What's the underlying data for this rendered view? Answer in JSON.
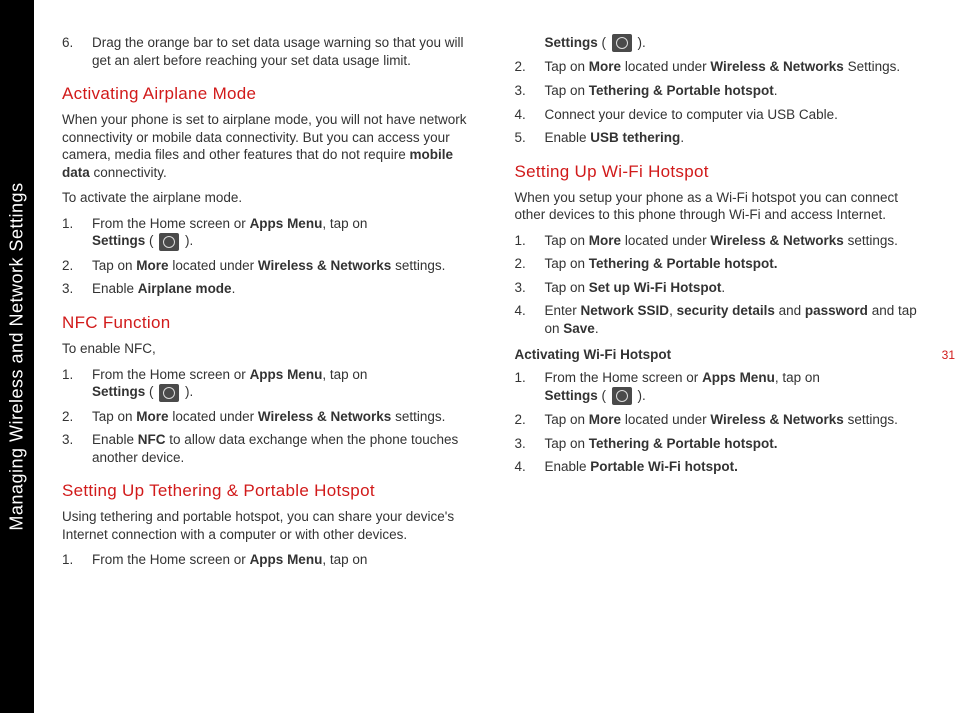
{
  "sidebar": {
    "title": "Managing Wireless and Network Settings"
  },
  "page_number": "31",
  "left": {
    "item6_num": "6.",
    "item6_text": "Drag the orange bar to set data usage warning so that you will get an alert before reaching your set data usage limit.",
    "heading_airplane": "Activating Airplane Mode",
    "airplane_intro_1": "When your phone is set to airplane mode, you will not have network connectivity or mobile data connectivity. But you can access your camera, media files and other features that do not require ",
    "airplane_intro_bold": "mobile data",
    "airplane_intro_2": " connectivity.",
    "airplane_activate": "To activate the airplane mode.",
    "airplane_steps": {
      "s1_num": "1.",
      "s1_a": "From the Home screen or ",
      "s1_b": "Apps Menu",
      "s1_c": ", tap on ",
      "s1_d": "Settings",
      "s1_e": " ( ",
      "s1_f": " ).",
      "s2_num": "2.",
      "s2_a": "Tap on ",
      "s2_b": "More",
      "s2_c": " located under ",
      "s2_d": "Wireless & Networks",
      "s2_e": " settings.",
      "s3_num": "3.",
      "s3_a": "Enable ",
      "s3_b": "Airplane mode",
      "s3_c": "."
    },
    "heading_nfc": "NFC Function",
    "nfc_intro": "To enable NFC,",
    "nfc_steps": {
      "s1_num": "1.",
      "s1_a": "From the Home screen or ",
      "s1_b": "Apps Menu",
      "s1_c": ", tap on ",
      "s1_d": "Settings",
      "s1_e": " ( ",
      "s1_f": " ).",
      "s2_num": "2.",
      "s2_a": "Tap on ",
      "s2_b": "More",
      "s2_c": " located under ",
      "s2_d": "Wireless & Networks",
      "s2_e": " settings.",
      "s3_num": "3.",
      "s3_a": "Enable ",
      "s3_b": "NFC",
      "s3_c": " to allow data exchange when the phone touches another device."
    },
    "heading_tether": "Setting Up Tethering & Portable Hotspot",
    "tether_intro": "Using tethering and portable hotspot, you can share your device's Internet connection with a computer or with other devices.",
    "tether_steps": {
      "s1_num": "1.",
      "s1_a": "From the Home screen or ",
      "s1_b": "Apps Menu",
      "s1_c": ", tap on "
    }
  },
  "right": {
    "cont": {
      "s1_d": "Settings",
      "s1_e": " ( ",
      "s1_f": " ).",
      "s2_num": "2.",
      "s2_a": "Tap on ",
      "s2_b": "More",
      "s2_c": " located under ",
      "s2_d": "Wireless & Networks",
      "s2_e": " Settings.",
      "s3_num": "3.",
      "s3_a": "Tap on ",
      "s3_b": "Tethering & Portable hotspot",
      "s3_c": ".",
      "s4_num": "4.",
      "s4_text": "Connect your device to computer via USB Cable.",
      "s5_num": "5.",
      "s5_a": "Enable ",
      "s5_b": "USB tethering",
      "s5_c": "."
    },
    "heading_wifi": "Setting Up Wi-Fi Hotspot",
    "wifi_intro": "When you setup your phone as a Wi-Fi hotspot you can connect other devices to this phone through Wi-Fi and access Internet.",
    "wifi_steps": {
      "s1_num": "1.",
      "s1_a": "Tap on ",
      "s1_b": "More",
      "s1_c": " located under ",
      "s1_d": "Wireless & Networks",
      "s1_e": " settings.",
      "s2_num": "2.",
      "s2_a": "Tap on ",
      "s2_b": "Tethering & Portable hotspot.",
      "s3_num": "3.",
      "s3_a": "Tap on ",
      "s3_b": "Set up Wi-Fi Hotspot",
      "s3_c": ".",
      "s4_num": "4.",
      "s4_a": "Enter ",
      "s4_b": "Network SSID",
      "s4_c": ", ",
      "s4_d": "security details",
      "s4_e": " and ",
      "s4_f": "password",
      "s4_g": " and tap on ",
      "s4_h": "Save",
      "s4_i": "."
    },
    "subheading_activating": "Activating Wi-Fi Hotspot",
    "act_steps": {
      "s1_num": "1.",
      "s1_a": "From the Home screen or ",
      "s1_b": "Apps Menu",
      "s1_c": ", tap on ",
      "s1_d": "Settings",
      "s1_e": " ( ",
      "s1_f": " ).",
      "s2_num": "2.",
      "s2_a": "Tap on ",
      "s2_b": "More",
      "s2_c": " located under ",
      "s2_d": "Wireless & Networks",
      "s2_e": " settings.",
      "s3_num": "3.",
      "s3_a": "Tap on ",
      "s3_b": "Tethering & Portable hotspot.",
      "s4_num": "4.",
      "s4_a": "Enable ",
      "s4_b": "Portable Wi-Fi hotspot."
    }
  }
}
